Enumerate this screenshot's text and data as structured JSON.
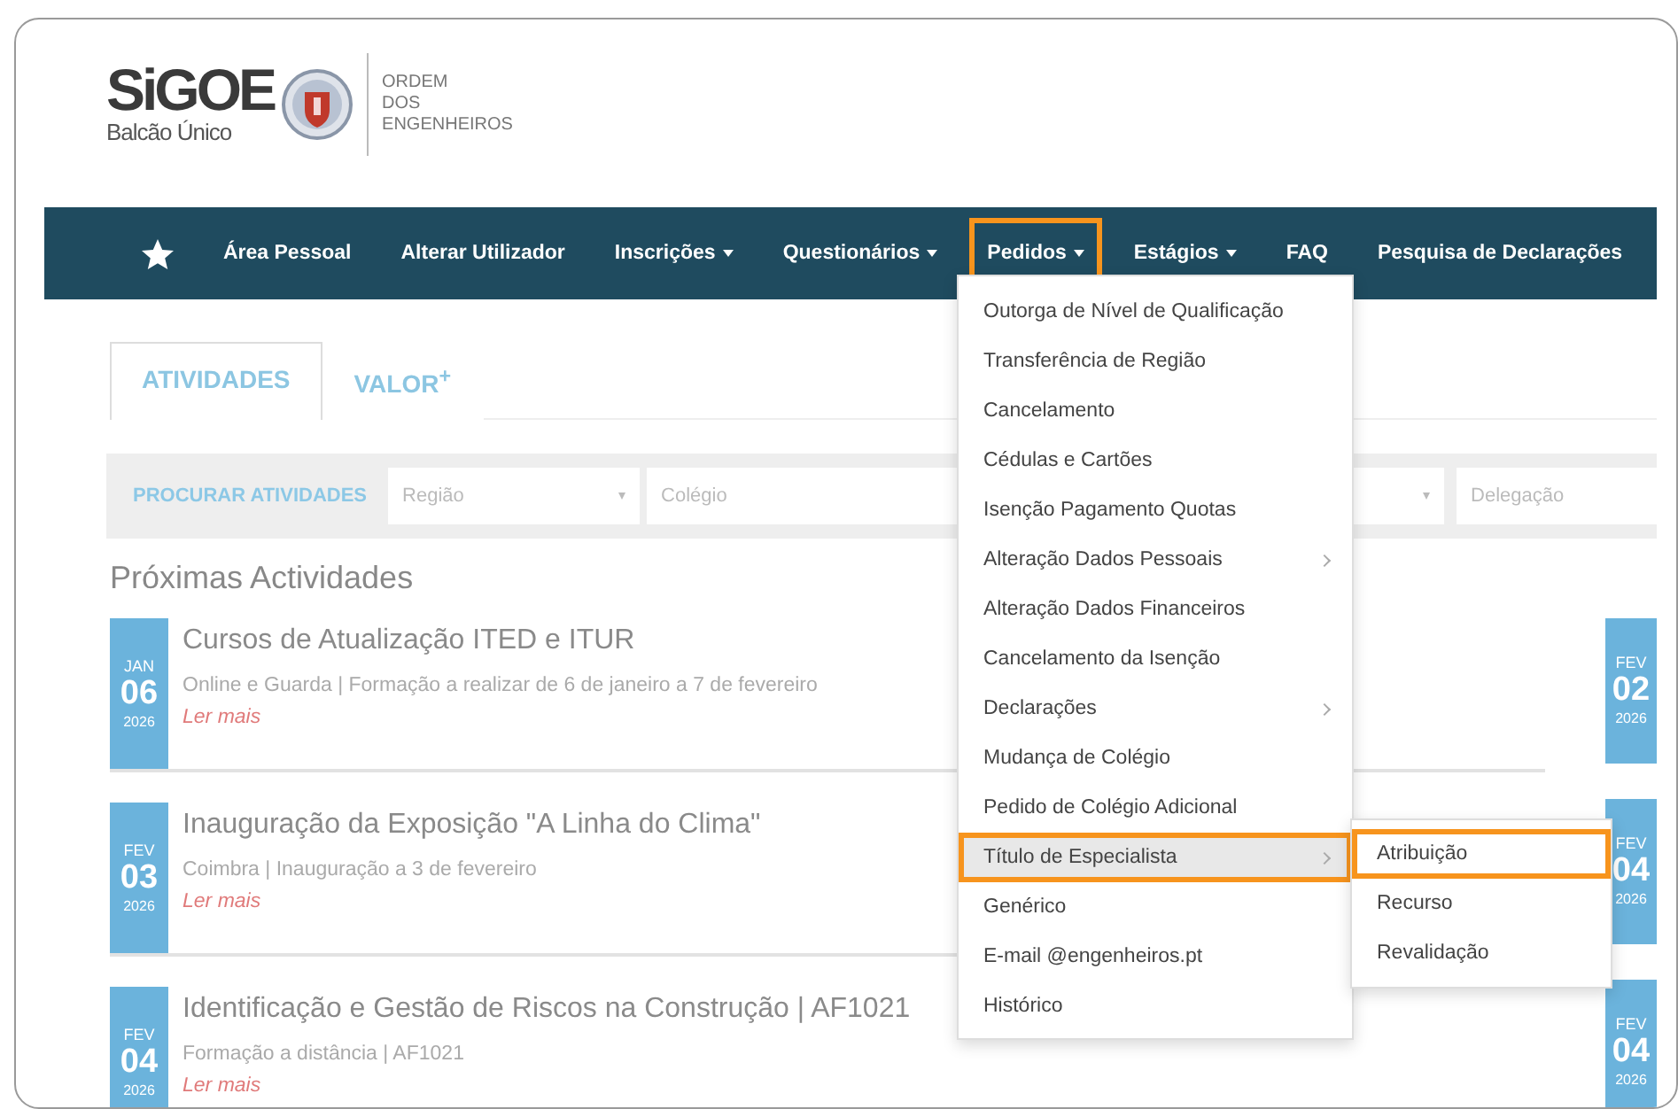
{
  "logo": {
    "name": "SiGOE",
    "subtitle": "Balcão Único",
    "org_lines": [
      "ORDEM",
      "DOS",
      "ENGENHEIROS"
    ]
  },
  "nav": {
    "items": [
      {
        "label": "Área Pessoal",
        "dropdown": false,
        "highlighted": false
      },
      {
        "label": "Alterar Utilizador",
        "dropdown": false,
        "highlighted": false
      },
      {
        "label": "Inscrições",
        "dropdown": true,
        "highlighted": false
      },
      {
        "label": "Questionários",
        "dropdown": true,
        "highlighted": false
      },
      {
        "label": "Pedidos",
        "dropdown": true,
        "highlighted": true
      },
      {
        "label": "Estágios",
        "dropdown": true,
        "highlighted": false
      },
      {
        "label": "FAQ",
        "dropdown": false,
        "highlighted": false
      },
      {
        "label": "Pesquisa de Declarações",
        "dropdown": false,
        "highlighted": false
      }
    ]
  },
  "tabs": [
    {
      "label": "ATIVIDADES",
      "selected": true
    },
    {
      "label": "VALOR$^{+}$",
      "selected": false
    }
  ],
  "search": {
    "label": "PROCURAR ATIVIDADES",
    "fields": [
      {
        "kind": "select",
        "placeholder": "Região"
      },
      {
        "kind": "select",
        "placeholder": "Colégio"
      },
      {
        "kind": "select"
      },
      {
        "kind": "text",
        "placeholder": "Delegação"
      }
    ]
  },
  "section_title": "Próximas Actividades",
  "events": [
    {
      "month": "JAN",
      "day": "06",
      "year": "2026",
      "title": "Cursos de Atualização ITED e ITUR",
      "details": "Online e Guarda | Formação a realizar de 6 de janeiro a 7 de fevereiro",
      "link": "Ler mais"
    },
    {
      "month": "FEV",
      "day": "03",
      "year": "2026",
      "title": "Inauguração da Exposição \"A Linha do Clima\"",
      "details": "Coimbra | Inauguração a 3 de fevereiro",
      "link": "Ler mais"
    },
    {
      "month": "FEV",
      "day": "04",
      "year": "2026",
      "title": "Identificação e Gestão de Riscos na Construção | AF1021",
      "details": "Formação a distância | AF1021",
      "link": "Ler mais"
    }
  ],
  "side_dates": [
    {
      "month": "FEV",
      "day": "02",
      "year": "2026"
    },
    {
      "month": "FEV",
      "day": "04",
      "year": "2026"
    },
    {
      "month": "FEV",
      "day": "04",
      "year": "2026"
    }
  ],
  "menu": {
    "items": [
      {
        "label": "Outorga de Nível de Qualificação",
        "has_submenu": false,
        "selected": false,
        "highlighted": false
      },
      {
        "label": "Transferência de Região",
        "has_submenu": false,
        "selected": false,
        "highlighted": false
      },
      {
        "label": "Cancelamento",
        "has_submenu": false,
        "selected": false,
        "highlighted": false
      },
      {
        "label": "Cédulas e Cartões",
        "has_submenu": false,
        "selected": false,
        "highlighted": false
      },
      {
        "label": "Isenção Pagamento Quotas",
        "has_submenu": false,
        "selected": false,
        "highlighted": false
      },
      {
        "label": "Alteração Dados Pessoais",
        "has_submenu": true,
        "selected": false,
        "highlighted": false
      },
      {
        "label": "Alteração Dados Financeiros",
        "has_submenu": false,
        "selected": false,
        "highlighted": false
      },
      {
        "label": "Cancelamento da Isenção",
        "has_submenu": false,
        "selected": false,
        "highlighted": false
      },
      {
        "label": "Declarações",
        "has_submenu": true,
        "selected": false,
        "highlighted": false
      },
      {
        "label": "Mudança de Colégio",
        "has_submenu": false,
        "selected": false,
        "highlighted": false
      },
      {
        "label": "Pedido de Colégio Adicional",
        "has_submenu": false,
        "selected": false,
        "highlighted": false
      },
      {
        "label": "Título de Especialista",
        "has_submenu": true,
        "selected": true,
        "highlighted": true
      },
      {
        "label": "Genérico",
        "has_submenu": false,
        "selected": false,
        "highlighted": false
      },
      {
        "label": "E-mail @engenheiros.pt",
        "has_submenu": false,
        "selected": false,
        "highlighted": false
      },
      {
        "label": "Histórico",
        "has_submenu": false,
        "selected": false,
        "highlighted": false
      }
    ],
    "submenu": {
      "items": [
        {
          "label": "Atribuição",
          "selected": false,
          "highlighted": true
        },
        {
          "label": "Recurso",
          "selected": false,
          "highlighted": false
        },
        {
          "label": "Revalidação",
          "selected": false,
          "highlighted": false
        }
      ]
    }
  }
}
